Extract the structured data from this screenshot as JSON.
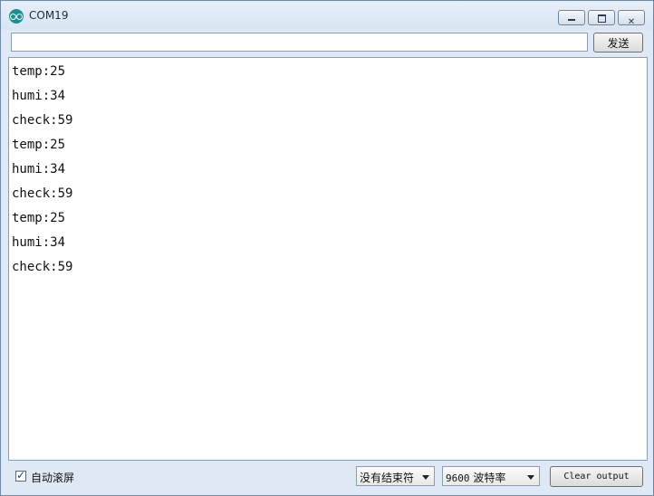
{
  "window": {
    "title": "COM19"
  },
  "send": {
    "input_value": "",
    "button_label": "发送"
  },
  "output": {
    "lines": [
      "temp:25",
      "humi:34",
      "check:59",
      "temp:25",
      "humi:34",
      "check:59",
      "temp:25",
      "humi:34",
      "check:59"
    ]
  },
  "footer": {
    "autoscroll_label": "自动滚屏",
    "autoscroll_checked": true,
    "line_ending_value": "没有结束符",
    "baud_number": "9600",
    "baud_unit": "波特率",
    "clear_label": "Clear output"
  },
  "colors": {
    "title_bar": "#dfe9f5",
    "app_icon": "#1b8f93"
  },
  "icons": {
    "app": "arduino-icon",
    "minimize": "minimize-icon",
    "maximize": "maximize-icon",
    "close": "close-icon",
    "dropdown": "chevron-down-icon"
  }
}
